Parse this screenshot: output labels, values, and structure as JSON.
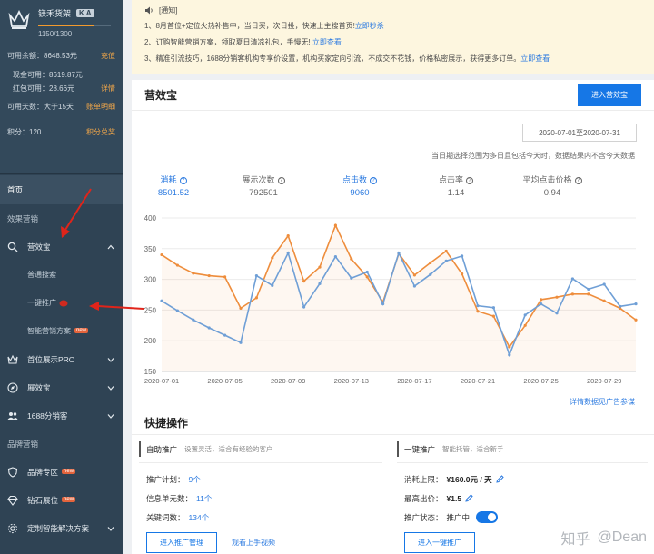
{
  "account": {
    "name": "镁禾货架",
    "badge": "K A",
    "progress_fraction": 0.77,
    "points_progress": "1150/1300",
    "available_balance_label": "可用余额：8648.53元",
    "recharge_link": "充值",
    "cash_label": "现金可用：8619.87元",
    "redpacket_label": "红包可用：28.66元",
    "details_link": "详情",
    "available_days_label": "可用天数：大于15天",
    "account_detail_link": "账单明细",
    "points_label": "积分：120",
    "points_link": "积分兑奖"
  },
  "sidebar": {
    "home": "首页",
    "section_effect": "效果营销",
    "yingxiaobao": "营效宝",
    "sub_normal": "普通搜索",
    "sub_onekey": "一键推广",
    "sub_smart": "智能营销方案",
    "new_tag": "new",
    "shouwei": "首位展示PRO",
    "zhanbao": "展效宝",
    "fenxiao": "1688分销客",
    "section_brand": "品牌营销",
    "brand_zone": "品牌专区",
    "diamond": "钻石展位",
    "custom": "定制智能解决方案"
  },
  "notice": {
    "title": "[通知]",
    "items": [
      {
        "text": "1、8月首位+定位火热补售中，当日买，次日投，快速上主搜首页!",
        "link": "立即秒杀"
      },
      {
        "text": "2、订购智能营销方案，领取夏日清凉礼包，手慢无!",
        "link": "立即查看"
      },
      {
        "text": "3、精准引流技巧，1688分销客机构专享价设置，机构买家定向引流，不成交不花钱，价格私密展示，获得更多订单。",
        "link": "立即查看"
      }
    ]
  },
  "main": {
    "title": "营效宝",
    "enter_button": "进入营效宝",
    "date_range": "2020-07-01至2020-07-31",
    "date_note": "当日期选择范围为多日且包括今天时，数据结果内不含今天数据",
    "metrics": [
      {
        "label": "消耗",
        "value": "8501.52",
        "highlight": true,
        "help": true
      },
      {
        "label": "展示次数",
        "value": "792501",
        "highlight": false,
        "help": true
      },
      {
        "label": "点击数",
        "value": "9060",
        "highlight": true,
        "help": true
      },
      {
        "label": "点击率",
        "value": "1.14",
        "highlight": false,
        "help": true
      },
      {
        "label": "平均点击价格",
        "value": "0.94",
        "highlight": false,
        "help": true
      }
    ],
    "chart_link": "详情数据见广告参谋"
  },
  "chart_data": {
    "type": "line",
    "x": [
      "2020-07-01",
      "2020-07-02",
      "2020-07-03",
      "2020-07-04",
      "2020-07-05",
      "2020-07-06",
      "2020-07-07",
      "2020-07-08",
      "2020-07-09",
      "2020-07-10",
      "2020-07-11",
      "2020-07-12",
      "2020-07-13",
      "2020-07-14",
      "2020-07-15",
      "2020-07-16",
      "2020-07-17",
      "2020-07-18",
      "2020-07-19",
      "2020-07-20",
      "2020-07-21",
      "2020-07-22",
      "2020-07-23",
      "2020-07-24",
      "2020-07-25",
      "2020-07-26",
      "2020-07-27",
      "2020-07-28",
      "2020-07-29",
      "2020-07-30",
      "2020-07-31"
    ],
    "tick_labels": [
      "2020-07-01",
      "2020-07-05",
      "2020-07-09",
      "2020-07-13",
      "2020-07-17",
      "2020-07-21",
      "2020-07-25",
      "2020-07-29"
    ],
    "series": [
      {
        "color": "#ee8d3c",
        "values": [
          340,
          323,
          310,
          306,
          304,
          253,
          270,
          335,
          371,
          297,
          320,
          388,
          333,
          304,
          263,
          342,
          307,
          327,
          346,
          309,
          248,
          240,
          190,
          225,
          267,
          271,
          276,
          276,
          265,
          253,
          234
        ]
      },
      {
        "color": "#6f9fd6",
        "values": [
          265,
          249,
          234,
          221,
          209,
          197,
          306,
          290,
          343,
          255,
          293,
          337,
          302,
          312,
          260,
          343,
          289,
          308,
          330,
          338,
          257,
          254,
          177,
          242,
          260,
          245,
          301,
          284,
          292,
          256,
          260
        ]
      }
    ],
    "ylim": [
      150,
      400
    ],
    "yticks": [
      150,
      200,
      250,
      300,
      350,
      400
    ],
    "grid": true
  },
  "quick": {
    "title": "快捷操作",
    "left": {
      "title": "自助推广",
      "desc": "设置灵活，适合有经验的客户",
      "plan_label": "推广计划：",
      "plan_value": "9个",
      "unit_label": "信息单元数：",
      "unit_value": "11个",
      "kw_label": "关键词数：",
      "kw_value": "134个",
      "manage_button": "进入推广管理",
      "video_link": "观看上手视频"
    },
    "right": {
      "title": "一键推广",
      "desc": "智能托管，适合新手",
      "limit_label": "消耗上限：",
      "limit_value": "¥160.0元 / 天",
      "bid_label": "最高出价：",
      "bid_value": "¥1.5",
      "status_label": "推广状态：",
      "status_value": "推广中",
      "enter_button": "进入一键推广"
    }
  },
  "watermark": {
    "brand": "知乎",
    "user": "@Dean"
  }
}
